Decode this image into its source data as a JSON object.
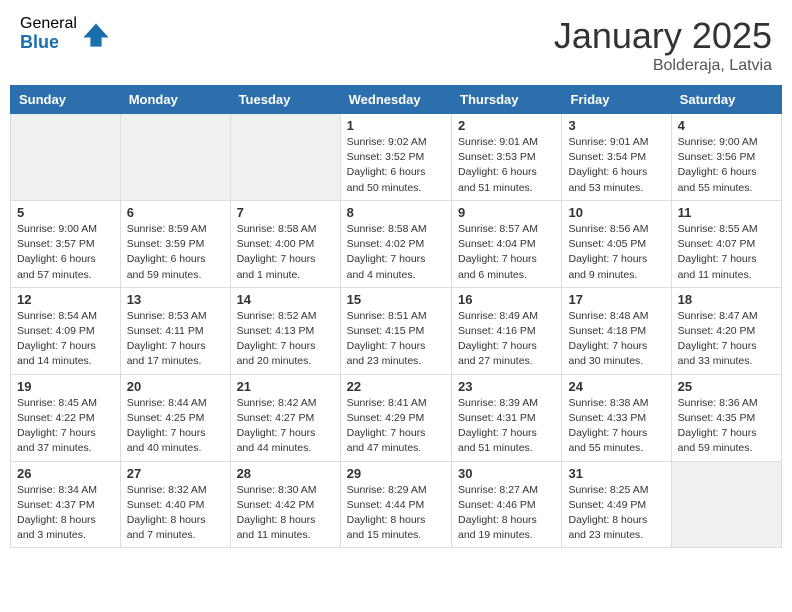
{
  "header": {
    "logo": {
      "general": "General",
      "blue": "Blue"
    },
    "title": "January 2025",
    "location": "Bolderaja, Latvia"
  },
  "weekdays": [
    "Sunday",
    "Monday",
    "Tuesday",
    "Wednesday",
    "Thursday",
    "Friday",
    "Saturday"
  ],
  "weeks": [
    [
      {
        "day": "",
        "info": ""
      },
      {
        "day": "",
        "info": ""
      },
      {
        "day": "",
        "info": ""
      },
      {
        "day": "1",
        "info": "Sunrise: 9:02 AM\nSunset: 3:52 PM\nDaylight: 6 hours and 50 minutes."
      },
      {
        "day": "2",
        "info": "Sunrise: 9:01 AM\nSunset: 3:53 PM\nDaylight: 6 hours and 51 minutes."
      },
      {
        "day": "3",
        "info": "Sunrise: 9:01 AM\nSunset: 3:54 PM\nDaylight: 6 hours and 53 minutes."
      },
      {
        "day": "4",
        "info": "Sunrise: 9:00 AM\nSunset: 3:56 PM\nDaylight: 6 hours and 55 minutes."
      }
    ],
    [
      {
        "day": "5",
        "info": "Sunrise: 9:00 AM\nSunset: 3:57 PM\nDaylight: 6 hours and 57 minutes."
      },
      {
        "day": "6",
        "info": "Sunrise: 8:59 AM\nSunset: 3:59 PM\nDaylight: 6 hours and 59 minutes."
      },
      {
        "day": "7",
        "info": "Sunrise: 8:58 AM\nSunset: 4:00 PM\nDaylight: 7 hours and 1 minute."
      },
      {
        "day": "8",
        "info": "Sunrise: 8:58 AM\nSunset: 4:02 PM\nDaylight: 7 hours and 4 minutes."
      },
      {
        "day": "9",
        "info": "Sunrise: 8:57 AM\nSunset: 4:04 PM\nDaylight: 7 hours and 6 minutes."
      },
      {
        "day": "10",
        "info": "Sunrise: 8:56 AM\nSunset: 4:05 PM\nDaylight: 7 hours and 9 minutes."
      },
      {
        "day": "11",
        "info": "Sunrise: 8:55 AM\nSunset: 4:07 PM\nDaylight: 7 hours and 11 minutes."
      }
    ],
    [
      {
        "day": "12",
        "info": "Sunrise: 8:54 AM\nSunset: 4:09 PM\nDaylight: 7 hours and 14 minutes."
      },
      {
        "day": "13",
        "info": "Sunrise: 8:53 AM\nSunset: 4:11 PM\nDaylight: 7 hours and 17 minutes."
      },
      {
        "day": "14",
        "info": "Sunrise: 8:52 AM\nSunset: 4:13 PM\nDaylight: 7 hours and 20 minutes."
      },
      {
        "day": "15",
        "info": "Sunrise: 8:51 AM\nSunset: 4:15 PM\nDaylight: 7 hours and 23 minutes."
      },
      {
        "day": "16",
        "info": "Sunrise: 8:49 AM\nSunset: 4:16 PM\nDaylight: 7 hours and 27 minutes."
      },
      {
        "day": "17",
        "info": "Sunrise: 8:48 AM\nSunset: 4:18 PM\nDaylight: 7 hours and 30 minutes."
      },
      {
        "day": "18",
        "info": "Sunrise: 8:47 AM\nSunset: 4:20 PM\nDaylight: 7 hours and 33 minutes."
      }
    ],
    [
      {
        "day": "19",
        "info": "Sunrise: 8:45 AM\nSunset: 4:22 PM\nDaylight: 7 hours and 37 minutes."
      },
      {
        "day": "20",
        "info": "Sunrise: 8:44 AM\nSunset: 4:25 PM\nDaylight: 7 hours and 40 minutes."
      },
      {
        "day": "21",
        "info": "Sunrise: 8:42 AM\nSunset: 4:27 PM\nDaylight: 7 hours and 44 minutes."
      },
      {
        "day": "22",
        "info": "Sunrise: 8:41 AM\nSunset: 4:29 PM\nDaylight: 7 hours and 47 minutes."
      },
      {
        "day": "23",
        "info": "Sunrise: 8:39 AM\nSunset: 4:31 PM\nDaylight: 7 hours and 51 minutes."
      },
      {
        "day": "24",
        "info": "Sunrise: 8:38 AM\nSunset: 4:33 PM\nDaylight: 7 hours and 55 minutes."
      },
      {
        "day": "25",
        "info": "Sunrise: 8:36 AM\nSunset: 4:35 PM\nDaylight: 7 hours and 59 minutes."
      }
    ],
    [
      {
        "day": "26",
        "info": "Sunrise: 8:34 AM\nSunset: 4:37 PM\nDaylight: 8 hours and 3 minutes."
      },
      {
        "day": "27",
        "info": "Sunrise: 8:32 AM\nSunset: 4:40 PM\nDaylight: 8 hours and 7 minutes."
      },
      {
        "day": "28",
        "info": "Sunrise: 8:30 AM\nSunset: 4:42 PM\nDaylight: 8 hours and 11 minutes."
      },
      {
        "day": "29",
        "info": "Sunrise: 8:29 AM\nSunset: 4:44 PM\nDaylight: 8 hours and 15 minutes."
      },
      {
        "day": "30",
        "info": "Sunrise: 8:27 AM\nSunset: 4:46 PM\nDaylight: 8 hours and 19 minutes."
      },
      {
        "day": "31",
        "info": "Sunrise: 8:25 AM\nSunset: 4:49 PM\nDaylight: 8 hours and 23 minutes."
      },
      {
        "day": "",
        "info": ""
      }
    ]
  ]
}
